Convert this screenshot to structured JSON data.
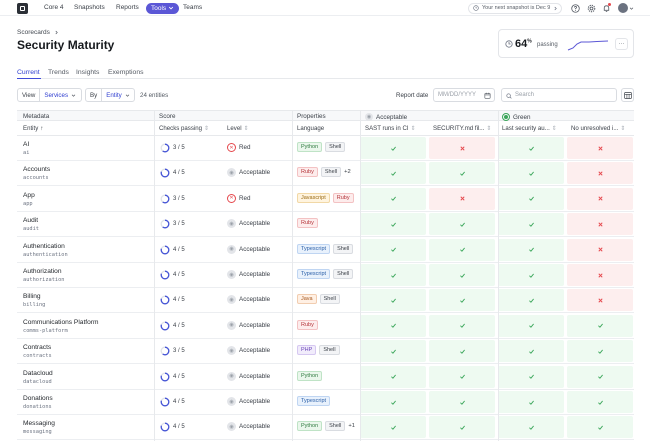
{
  "nav": {
    "items": [
      "Core 4",
      "Snapshots",
      "Reports"
    ],
    "tools_label": "Tools",
    "teams_label": "Teams",
    "snapshot_text": "Your next snapshot is Dec 9"
  },
  "header": {
    "breadcrumb": "Scorecards",
    "title": "Security Maturity",
    "stat_value": "64",
    "stat_unit": "%",
    "stat_label": "passing",
    "more_label": "···"
  },
  "tabs": [
    "Current",
    "Trends",
    "Insights",
    "Exemptions"
  ],
  "toolbar": {
    "view_label": "View",
    "view_value": "Services",
    "by_label": "By",
    "by_value": "Entity",
    "entity_count": "24 entities",
    "report_date_label": "Report date",
    "date_placeholder": "MM/DD/YYYY",
    "search_placeholder": "Search"
  },
  "table": {
    "groups": [
      "Metadata",
      "Score",
      "Properties",
      "Acceptable",
      "Green"
    ],
    "headers": [
      "Entity",
      "Checks passing",
      "Level",
      "Language",
      "SAST runs in CI",
      "SECURITY.md fil...",
      "Last security au...",
      "No unresolved i..."
    ],
    "rows": [
      {
        "name": "AI",
        "slug": "ai",
        "checks": "3 / 5",
        "ratio": 0.6,
        "level": "Red",
        "tags": [
          "Python",
          "Shell"
        ],
        "more": "",
        "results": [
          1,
          0,
          1,
          0
        ]
      },
      {
        "name": "Accounts",
        "slug": "accounts",
        "checks": "4 / 5",
        "ratio": 0.8,
        "level": "Acceptable",
        "tags": [
          "Ruby",
          "Shell"
        ],
        "more": "+2",
        "results": [
          1,
          1,
          1,
          0
        ]
      },
      {
        "name": "App",
        "slug": "app",
        "checks": "3 / 5",
        "ratio": 0.6,
        "level": "Red",
        "tags": [
          "Javascript",
          "Ruby"
        ],
        "more": "",
        "results": [
          1,
          0,
          1,
          0
        ]
      },
      {
        "name": "Audit",
        "slug": "audit",
        "checks": "3 / 5",
        "ratio": 0.6,
        "level": "Acceptable",
        "tags": [
          "Ruby"
        ],
        "more": "",
        "results": [
          1,
          1,
          1,
          0
        ]
      },
      {
        "name": "Authentication",
        "slug": "authentication",
        "checks": "4 / 5",
        "ratio": 0.8,
        "level": "Acceptable",
        "tags": [
          "Typescript",
          "Shell"
        ],
        "more": "",
        "results": [
          1,
          1,
          1,
          0
        ]
      },
      {
        "name": "Authorization",
        "slug": "authorization",
        "checks": "4 / 5",
        "ratio": 0.8,
        "level": "Acceptable",
        "tags": [
          "Typescript",
          "Shell"
        ],
        "more": "",
        "results": [
          1,
          1,
          1,
          0
        ]
      },
      {
        "name": "Billing",
        "slug": "billing",
        "checks": "4 / 5",
        "ratio": 0.8,
        "level": "Acceptable",
        "tags": [
          "Java",
          "Shell"
        ],
        "more": "",
        "results": [
          1,
          1,
          1,
          0
        ]
      },
      {
        "name": "Communications Platform",
        "slug": "comms-platform",
        "checks": "4 / 5",
        "ratio": 0.8,
        "level": "Acceptable",
        "tags": [
          "Ruby"
        ],
        "more": "",
        "results": [
          1,
          1,
          1,
          1
        ]
      },
      {
        "name": "Contracts",
        "slug": "contracts",
        "checks": "3 / 5",
        "ratio": 0.6,
        "level": "Acceptable",
        "tags": [
          "PHP",
          "Shell"
        ],
        "more": "",
        "results": [
          1,
          1,
          1,
          1
        ]
      },
      {
        "name": "Datacloud",
        "slug": "datacloud",
        "checks": "4 / 5",
        "ratio": 0.8,
        "level": "Acceptable",
        "tags": [
          "Python"
        ],
        "more": "",
        "results": [
          1,
          1,
          1,
          1
        ]
      },
      {
        "name": "Donations",
        "slug": "donations",
        "checks": "4 / 5",
        "ratio": 0.8,
        "level": "Acceptable",
        "tags": [
          "Typescript"
        ],
        "more": "",
        "results": [
          1,
          1,
          1,
          1
        ]
      },
      {
        "name": "Messaging",
        "slug": "messaging",
        "checks": "4 / 5",
        "ratio": 0.8,
        "level": "Acceptable",
        "tags": [
          "Python",
          "Shell"
        ],
        "more": "+1",
        "results": [
          1,
          1,
          1,
          1
        ]
      }
    ]
  },
  "tag_colors": {
    "Python": {
      "bg": "#eaf7ec",
      "fg": "#2f7a3f",
      "bd": "#bfe3c6"
    },
    "Shell": {
      "bg": "#f3f4f6",
      "fg": "#3b4048",
      "bd": "#d9dce1"
    },
    "Ruby": {
      "bg": "#fdecec",
      "fg": "#b4353a",
      "bd": "#f3c2c3"
    },
    "Javascript": {
      "bg": "#fff4df",
      "fg": "#9a6a12",
      "bd": "#f1d8a6"
    },
    "Typescript": {
      "bg": "#e8f1fc",
      "fg": "#2a5fa8",
      "bd": "#bfd5f2"
    },
    "Java": {
      "bg": "#fff0e4",
      "fg": "#a5561d",
      "bd": "#f1cdb0"
    },
    "PHP": {
      "bg": "#f1ecfb",
      "fg": "#6a44b8",
      "bd": "#d6c8f1"
    }
  },
  "colors": {
    "accent": "#5b57d6",
    "pass": "#3aa65a",
    "fail": "#e5484d"
  }
}
